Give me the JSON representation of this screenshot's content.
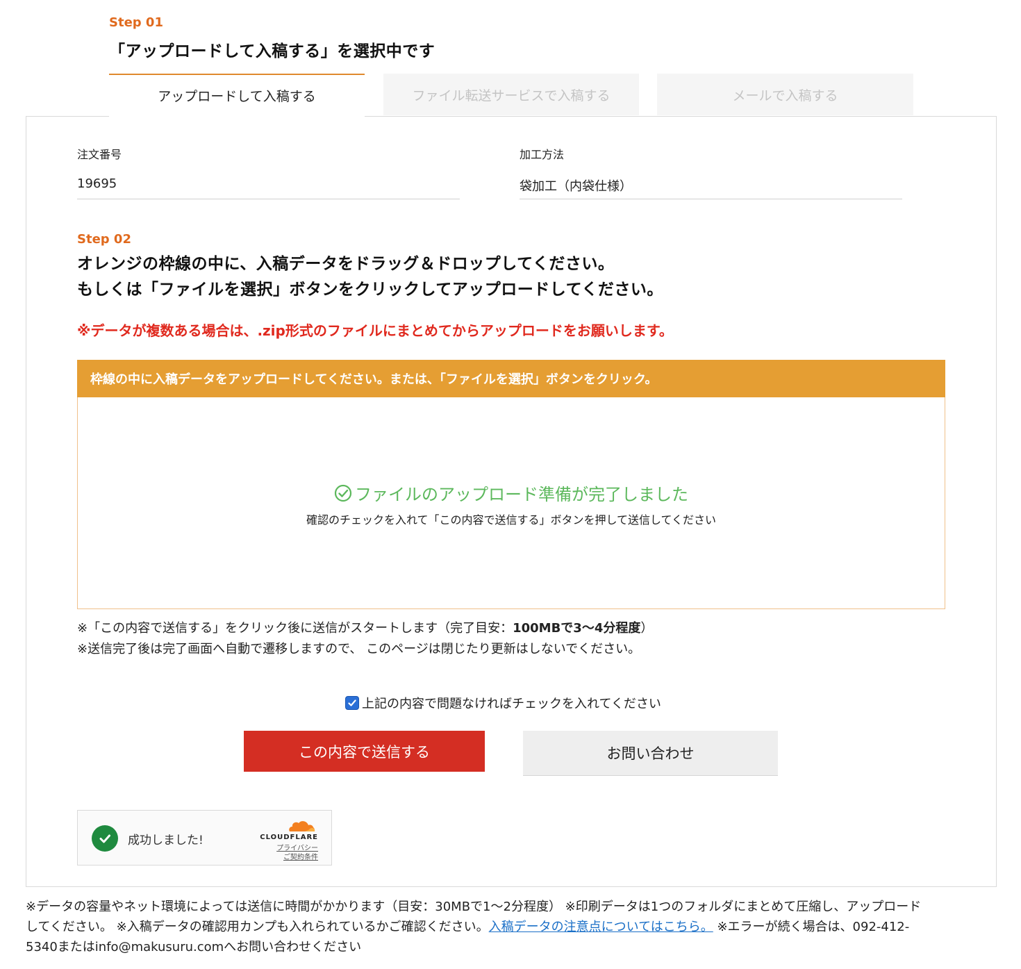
{
  "step1": {
    "label": "Step 01",
    "title": "「アップロードして入稿する」を選択中です"
  },
  "tabs": [
    {
      "label": "アップロードして入稿する",
      "active": true
    },
    {
      "label": "ファイル転送サービスで入稿する",
      "active": false
    },
    {
      "label": "メールで入稿する",
      "active": false
    }
  ],
  "order": {
    "number_label": "注文番号",
    "number_value": "19695",
    "method_label": "加工方法",
    "method_value": "袋加工（内袋仕様）"
  },
  "step2": {
    "label": "Step 02",
    "line1": "オレンジの枠線の中に、入稿データをドラッグ＆ドロップしてください。",
    "line2": "もしくは「ファイルを選択」ボタンをクリックしてアップロードしてください。",
    "note": "※データが複数ある場合は、.zip形式のファイルにまとめてからアップロードをお願いします。"
  },
  "dropzone": {
    "header": "枠線の中に入稿データをアップロードしてください。または、「ファイルを選択」ボタンをクリック。",
    "ready_text": "ファイルのアップロード準備が完了しました",
    "ready_sub": "確認のチェックを入れて「この内容で送信する」ボタンを押して送信してください"
  },
  "notes": {
    "line1_prefix": "※「この内容で送信する」をクリック後に送信がスタートします（完了目安：",
    "line1_bold": "100MBで3〜4分程度",
    "line1_suffix": "）",
    "line2": "※送信完了後は完了画面へ自動で遷移しますので、 このページは閉じたり更新はしないでください。"
  },
  "confirm": {
    "checked": true,
    "label": "上記の内容で問題なければチェックを入れてください"
  },
  "buttons": {
    "send": "この内容で送信する",
    "contact": "お問い合わせ"
  },
  "cloudflare": {
    "status": "成功しました!",
    "brand": "CLOUDFLARE",
    "privacy": "プライバシー",
    "terms": "ご契約条件"
  },
  "footer": {
    "text1": "※データの容量やネット環境によっては送信に時間がかかります（目安：30MBで1〜2分程度） ※印刷データは1つのフォルダにまとめて圧縮し、アップロードしてください。 ※入稿データの確認用カンプも入れられているかご確認ください。",
    "link": "入稿データの注意点についてはこちら。",
    "text2": " ※エラーが続く場合は、092-412-5340またはinfo@makusuru.comへお問い合わせください"
  },
  "colors": {
    "accent_orange": "#e06a1e",
    "drop_header": "#e59e33",
    "send_button": "#d42e23",
    "warning_red": "#e0291e",
    "success_green": "#5cb85c",
    "link_blue": "#1a6fc7"
  }
}
